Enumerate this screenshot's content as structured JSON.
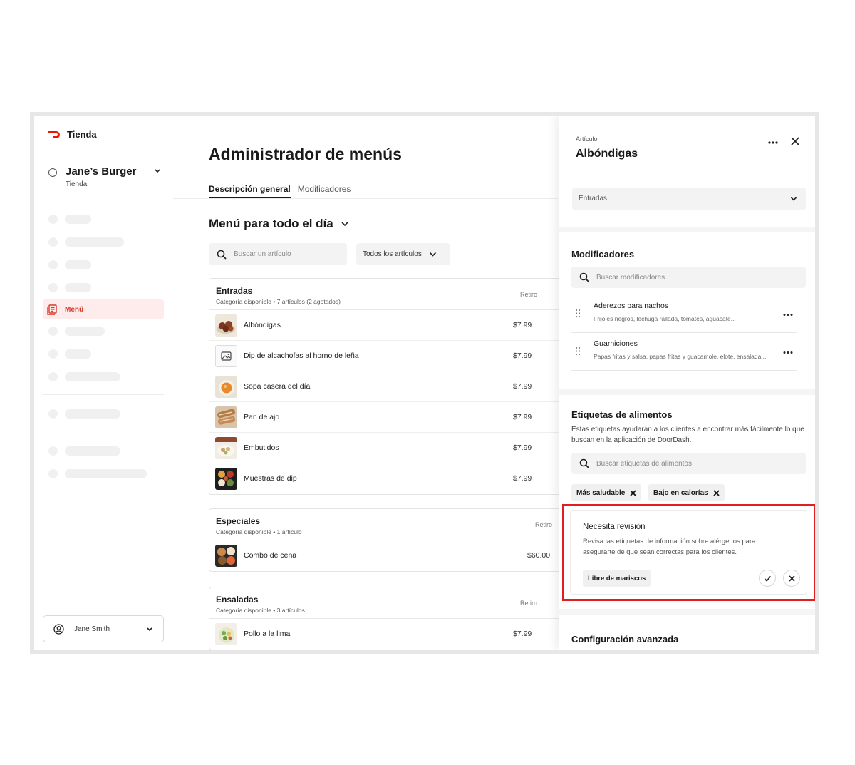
{
  "sidebar": {
    "brand": "Tienda",
    "store": {
      "name": "Jane’s Burger",
      "sub": "Tienda"
    },
    "active_item": "Menú",
    "user": "Jane Smith"
  },
  "main": {
    "title": "Administrador de menús",
    "tabs": [
      "Descripción general",
      "Modificadores"
    ],
    "menu_name": "Menú para todo el día",
    "search_placeholder": "Buscar un artículo",
    "filter": "Todos los artículos",
    "categories": [
      {
        "name": "Entradas",
        "sub": "Categoría disponible • 7 artículos (2 agotados)",
        "column": "Retiro",
        "items": [
          {
            "name": "Albóndigas",
            "price": "$7.99"
          },
          {
            "name": "Dip de alcachofas al horno de leña",
            "price": "$7.99"
          },
          {
            "name": "Sopa casera del día",
            "price": "$7.99"
          },
          {
            "name": "Pan de ajo",
            "price": "$7.99"
          },
          {
            "name": "Embutidos",
            "price": "$7.99"
          },
          {
            "name": "Muestras de dip",
            "price": "$7.99"
          }
        ]
      },
      {
        "name": "Especiales",
        "sub": "Categoría disponible • 1 artículo",
        "column": "Retiro",
        "items": [
          {
            "name": "Combo de cena",
            "price": "$60.00"
          }
        ]
      },
      {
        "name": "Ensaladas",
        "sub": "Categoría disponible • 3 artículos",
        "column": "Retiro",
        "items": [
          {
            "name": "Pollo a la lima",
            "price": "$7.99"
          }
        ]
      }
    ]
  },
  "panel": {
    "label": "Artículo",
    "title": "Albóndigas",
    "category": "Entradas",
    "modifiers": {
      "title": "Modificadores",
      "search_placeholder": "Buscar modificadores",
      "items": [
        {
          "name": "Aderezos para nachos",
          "desc": "Frijoles negros, lechuga rallada, tomates, aguacate..."
        },
        {
          "name": "Guarniciones",
          "desc": "Papas fritas y salsa, papas fritas y guacamole, elote, ensalada..."
        }
      ]
    },
    "tags": {
      "title": "Etiquetas de alimentos",
      "desc": "Estas etiquetas ayudarán a los clientes a encontrar más fácilmente lo que buscan en la aplicación de DoorDash.",
      "search_placeholder": "Buscar etiquetas de alimentos",
      "chips": [
        "Más saludable",
        "Bajo en calorías"
      ]
    },
    "review": {
      "title": "Necesita revisión",
      "desc": "Revisa las etiquetas de información sobre alérgenos para asegurarte de que sean correctas para los clientes.",
      "chip": "Libre de mariscos"
    },
    "advanced": "Configuración avanzada"
  },
  "colors": {
    "brand": "#eb1700",
    "highlight": "#e02020",
    "active_bg": "#fdeceb"
  }
}
